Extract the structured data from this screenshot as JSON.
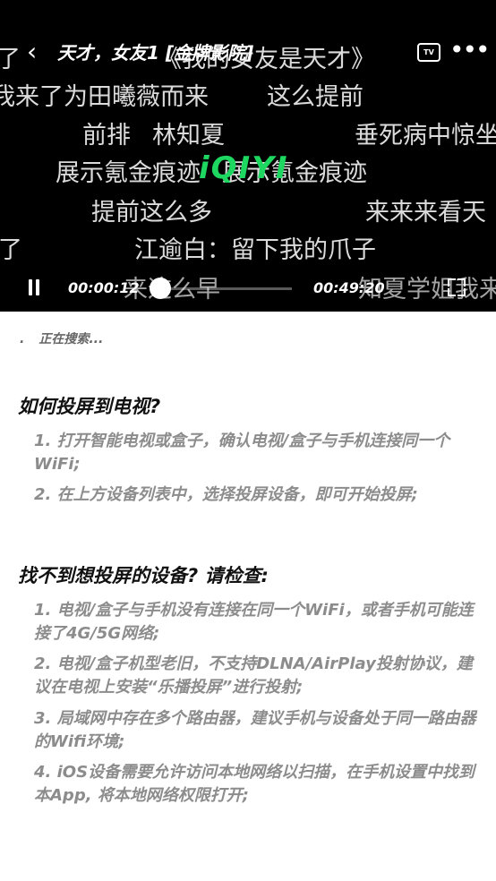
{
  "player": {
    "title": "天才，女友1 [金牌影院]",
    "back_icon": "chevron-left-icon",
    "cast_icon_label": "TV",
    "more_icon": "more-icon",
    "logo_text": "iQIYI",
    "logo_color": "#1ed760",
    "current_time": "00:00:12",
    "total_time": "00:49:20",
    "progress_fraction": 0.004
  },
  "danmaku": [
    "了",
    "《我的女友是天才》",
    "我来了为田曦薇而来",
    "这么提前",
    "前排",
    "林知夏",
    "垂死病中惊坐",
    "展示氪金痕迹",
    "展示氪金痕迹",
    "提前这么多",
    "来来来看天",
    "了",
    "江逾白：留下我的爪子",
    "来这么早",
    "知夏学姐我来"
  ],
  "cast": {
    "status_text": "正在搜索...",
    "how_title": "如何投屏到电视?",
    "how_items": [
      "1. 打开智能电视或盒子，确认电视/盒子与手机连接同一个WiFi;",
      "2. 在上方设备列表中，选择投屏设备，即可开始投屏;"
    ],
    "check_title": "找不到想投屏的设备? 请检查:",
    "check_items": [
      "1. 电视/盒子与手机没有连接在同一个WiFi，或者手机可能连接了4G/5G网络;",
      "2. 电视/盒子机型老旧，不支持DLNA/AirPlay投射协议，建议在电视上安装“乐播投屏”进行投射;",
      "3. 局域网中存在多个路由器，建议手机与设备处于同一路由器的Wifi环境;",
      "4. iOS设备需要允许访问本地网络以扫描，在手机设置中找到本App, 将本地网络权限打开;"
    ]
  }
}
